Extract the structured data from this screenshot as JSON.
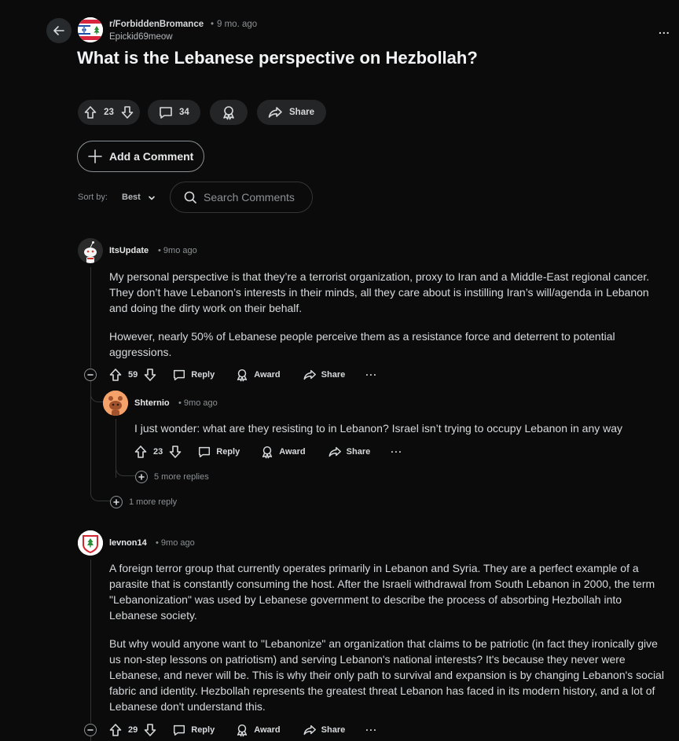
{
  "post": {
    "subreddit": "r/ForbiddenBromance",
    "separator": "•",
    "time": "9 mo. ago",
    "author": "Epickid69meow",
    "title": "What is the Lebanese perspective on Hezbollah?",
    "votes": "23",
    "comments": "34",
    "share_label": "Share",
    "more": "..."
  },
  "add_comment_label": "Add a Comment",
  "sort": {
    "label": "Sort by:",
    "value": "Best"
  },
  "search": {
    "placeholder": "Search Comments"
  },
  "actions": {
    "reply": "Reply",
    "award": "Award",
    "share": "Share",
    "more": "···"
  },
  "comments": [
    {
      "user": "ItsUpdate",
      "time": "• 9mo ago",
      "paragraphs": [
        "My personal perspective is that they’re a terrorist organization, proxy to Iran and a Middle-East regional cancer. They don’t have Lebanon’s interests in their minds, all they care about is instilling Iran’s will/agenda in Lebanon and doing the dirty work on their behalf.",
        "However, nearly 50% of Lebanese people perceive them as a resistance force and deterrent to potential aggressions."
      ],
      "votes": "59",
      "more_replies": "1 more reply"
    },
    {
      "user": "Shternio",
      "time": "• 9mo ago",
      "paragraphs": [
        "I just wonder: what are they resisting to in Lebanon? Israel isn’t trying to occupy Lebanon in any way"
      ],
      "votes": "23",
      "more_replies": "5 more replies"
    },
    {
      "user": "levnon14",
      "time": "• 9mo ago",
      "paragraphs": [
        "A foreign terror group that currently operates primarily in Lebanon and Syria. They are a perfect example of a parasite that is constantly consuming the host. After the Israeli withdrawal from South Lebanon in 2000, the term \"Lebanonization\" was used by Lebanese government to describe the process of absorbing Hezbollah into Lebanese society.",
        "But why would anyone want to \"Lebanonize\" an organization that claims to be patriotic (in fact they ironically give us non-step lessons on patriotism) and serving Lebanon's national interests? It's because they never were Lebanese, and never will be. This is why their only path to survival and expansion is by changing Lebanon's social fabric and identity. Hezbollah represents the greatest threat Lebanon has faced in its modern history, and a lot of Lebanese don't understand this."
      ],
      "votes": "29"
    }
  ]
}
